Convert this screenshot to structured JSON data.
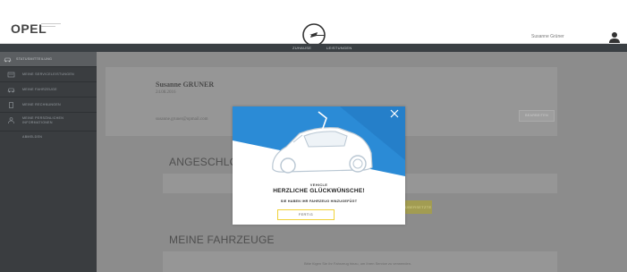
{
  "header": {
    "logo": "OPEL",
    "user_name": "Susanne Grüner"
  },
  "nav": {
    "items": [
      "ZUHAUSE",
      "LEISTUNGEN"
    ]
  },
  "sidebar": {
    "title": "STATUSMITTEILUNG",
    "items": [
      {
        "label": "MEINE SERVICELEISTUNGEN",
        "icon": "service-icon"
      },
      {
        "label": "MEINE FAHRZEUGE",
        "icon": "car-icon"
      },
      {
        "label": "MEINE RECHNUNGEN",
        "icon": "document-icon"
      },
      {
        "label": "MEINE PERSÖNLICHEN INFORMATIONEN",
        "icon": "person-icon"
      }
    ],
    "logout": "ABMELDEN"
  },
  "profile": {
    "name": "Susanne GRUNER",
    "date": "24.08.2016",
    "email": "susanne.gruner@opmail.com",
    "edit_label": "BEARBEITEN"
  },
  "sections": {
    "connected_title": "ANGESCHLOSSEN",
    "connected_action": "ÜBERSETZTE",
    "vehicles_title": "MEINE FAHRZEUGE",
    "vehicles_message": "Bitte fügen Sie Ihr Fahrzeug hinzu, um Ihren Service zu verwenden."
  },
  "modal": {
    "kicker": "VEHICLE",
    "title": "HERZLICHE GLÜCKWÜNSCHE!",
    "subtitle": "SIE HABEN IHR FAHRZEUG HINZUGEFÜGT",
    "button_label": "FERTIG"
  },
  "colors": {
    "nav": "#3a3f43",
    "sidebar": "#3a3d40",
    "modal_blue": "#2b8bd6",
    "accent_yellow": "#f0d23a"
  }
}
